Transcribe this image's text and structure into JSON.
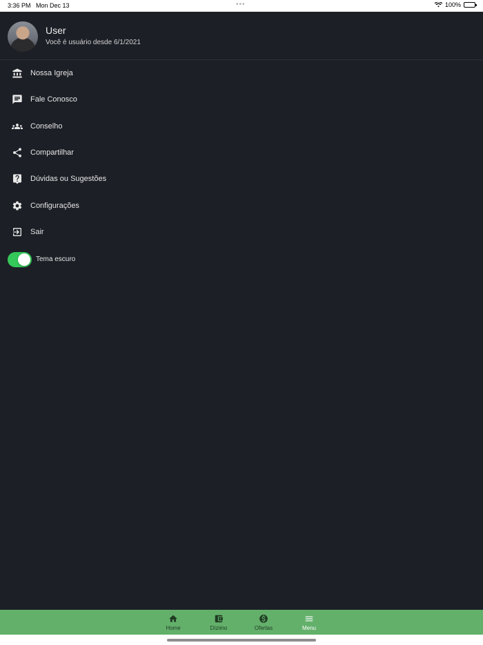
{
  "status_bar": {
    "time": "3:36 PM",
    "date": "Mon Dec 13",
    "battery": "100%"
  },
  "profile": {
    "name": "User",
    "since": "Você é usuário desde 6/1/2021"
  },
  "menu": {
    "items": [
      {
        "label": "Nossa Igreja",
        "icon": "bank-icon"
      },
      {
        "label": "Fale Conosco",
        "icon": "chat-icon"
      },
      {
        "label": "Conselho",
        "icon": "group-icon"
      },
      {
        "label": "Compartilhar",
        "icon": "share-icon"
      },
      {
        "label": "Dúvidas ou Sugestões",
        "icon": "help-icon"
      },
      {
        "label": "Configurações",
        "icon": "gear-icon"
      },
      {
        "label": "Sair",
        "icon": "logout-icon"
      }
    ]
  },
  "theme": {
    "label": "Tema escuro",
    "enabled": true
  },
  "tabbar": {
    "tabs": [
      {
        "label": "Home",
        "icon": "home-icon"
      },
      {
        "label": "Dízimo",
        "icon": "wallet-icon"
      },
      {
        "label": "Ofertas",
        "icon": "dollar-icon"
      },
      {
        "label": "Menu",
        "icon": "hamburger-icon",
        "active": true
      }
    ]
  },
  "colors": {
    "background": "#1c1f26",
    "tabbar": "#63b06b",
    "toggle_on": "#34c759"
  }
}
